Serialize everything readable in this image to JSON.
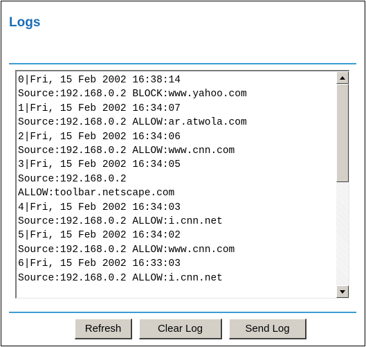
{
  "page": {
    "title": "Logs"
  },
  "log": {
    "lines": [
      "0|Fri, 15 Feb 2002 16:38:14",
      "Source:192.168.0.2 BLOCK:www.yahoo.com",
      "1|Fri, 15 Feb 2002 16:34:07",
      "Source:192.168.0.2 ALLOW:ar.atwola.com",
      "2|Fri, 15 Feb 2002 16:34:06",
      "Source:192.168.0.2 ALLOW:www.cnn.com",
      "3|Fri, 15 Feb 2002 16:34:05",
      "Source:192.168.0.2",
      "ALLOW:toolbar.netscape.com",
      "4|Fri, 15 Feb 2002 16:34:03",
      "Source:192.168.0.2 ALLOW:i.cnn.net",
      "5|Fri, 15 Feb 2002 16:34:02",
      "Source:192.168.0.2 ALLOW:www.cnn.com",
      "6|Fri, 15 Feb 2002 16:33:03",
      "Source:192.168.0.2 ALLOW:i.cnn.net"
    ]
  },
  "buttons": {
    "refresh": "Refresh",
    "clear_log": "Clear Log",
    "send_log": "Send Log"
  },
  "colors": {
    "title": "#1a6eb5",
    "rule": "#3a9bd5",
    "button_face": "#d4d0c8"
  },
  "icons": {
    "scroll_up": "arrow-up-icon",
    "scroll_down": "arrow-down-icon"
  }
}
